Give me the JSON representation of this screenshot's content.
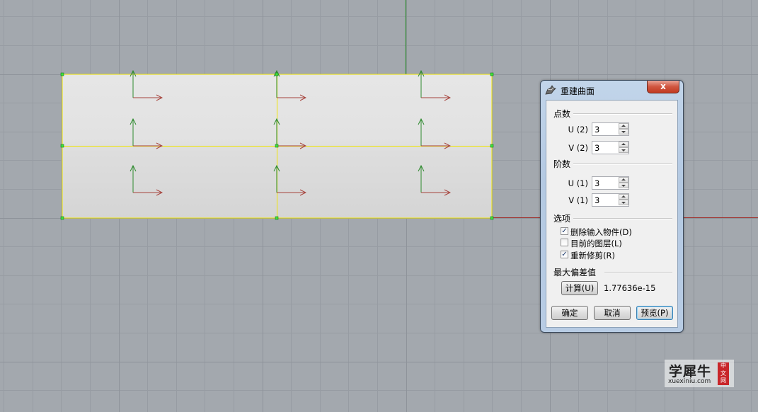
{
  "dialog": {
    "title": "重建曲面",
    "close_glyph": "x",
    "sections": {
      "point_count": "点数",
      "degree": "阶数",
      "options": "选项",
      "max_deviation": "最大偏差值"
    },
    "point_count": {
      "u_label": "U (2)",
      "u_value": "3",
      "v_label": "V (2)",
      "v_value": "3"
    },
    "degree": {
      "u_label": "U (1)",
      "u_value": "3",
      "v_label": "V (1)",
      "v_value": "3"
    },
    "options": [
      {
        "label": "删除输入物件(D)",
        "checked": true,
        "mark": "✓"
      },
      {
        "label": "目前的图层(L)",
        "checked": false,
        "mark": ""
      },
      {
        "label": "重新修剪(R)",
        "checked": true,
        "mark": "✓"
      }
    ],
    "calc_button": "计算(U)",
    "deviation_value": "1.77636e-15",
    "buttons": {
      "ok": "确定",
      "cancel": "取消",
      "preview": "预览(P)"
    }
  },
  "watermark": {
    "main": "学犀牛",
    "sub": "xuexiniu.com",
    "seal": "中文网"
  },
  "colors": {
    "viewport_bg": "#a3a8ae",
    "grid_line": "#979ca3",
    "surface_edge": "#f0e400",
    "control_point": "#3ee23e",
    "x_axis": "#a0302c",
    "y_axis": "#1e8a1e",
    "dialog_frame": "#b4c9e2"
  },
  "icons": [
    "rhino-app-icon",
    "close-icon",
    "spin-up-icon",
    "spin-down-icon",
    "checkmark-icon"
  ]
}
